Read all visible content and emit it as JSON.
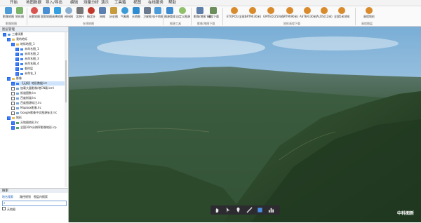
{
  "menu": [
    "开始",
    "地图数据",
    "导入/导出",
    "编辑",
    "测量分析",
    "演示",
    "工具箱",
    "视图",
    "在线服务",
    "帮助"
  ],
  "ribbon": {
    "buttons": [
      {
        "label": "影像地图",
        "icon": "image-map-icon",
        "color": "#4b9cd8"
      },
      {
        "label": "地形图",
        "icon": "terrain-map-icon",
        "color": "#7db46c"
      },
      {
        "label": "谷歌地图",
        "icon": "google-map-icon",
        "color": "#d9534f"
      },
      {
        "label": "国家地图",
        "icon": "national-map-icon",
        "color": "#4a8fd4"
      },
      {
        "label": "高德地图",
        "icon": "gaode-map-icon",
        "color": "#35a0e0"
      },
      {
        "label": "经纬网",
        "icon": "graticule-icon",
        "color": "#8ab0d0"
      },
      {
        "label": "比例尺",
        "icon": "scale-icon",
        "color": "#666666"
      },
      {
        "label": "指北针",
        "icon": "compass-icon",
        "color": "#c0392b"
      },
      {
        "label": "网格",
        "icon": "grid-icon",
        "color": "#5a7fb0"
      },
      {
        "label": "历史图",
        "icon": "history-map-icon",
        "color": "#c79a3b"
      },
      {
        "label": "气象图",
        "icon": "weather-icon",
        "color": "#3c9bd6"
      },
      {
        "label": "天地图",
        "icon": "tianditu-icon",
        "color": "#2f8cd1"
      },
      {
        "label": "卫星图",
        "icon": "satellite-icon",
        "color": "#6b7a8f"
      },
      {
        "label": "电子地图",
        "icon": "vector-map-icon",
        "color": "#4b9cd8"
      },
      {
        "label": "图源管理",
        "icon": "source-manage-icon",
        "color": "#3f8bcf"
      },
      {
        "label": "自定义图源",
        "icon": "custom-source-icon",
        "color": "#8fc16a"
      },
      {
        "label": "影像/地图下载",
        "icon": "download-icon",
        "color": "#5c7ea8"
      },
      {
        "label": "高程下载",
        "icon": "elevation-download-icon",
        "color": "#6b8e5a"
      },
      {
        "label": "ETOPO1(全球)",
        "icon": "dem-icon",
        "color": "#d98a2b"
      },
      {
        "label": "SRTM(30米)",
        "icon": "dem-icon",
        "color": "#d98a2b"
      },
      {
        "label": "GMTED(250米)",
        "icon": "dem-icon",
        "color": "#d98a2b"
      },
      {
        "label": "SRTM(90米)",
        "icon": "dem-icon",
        "color": "#d98a2b"
      },
      {
        "label": "ASTER(30米)",
        "icon": "dem-icon",
        "color": "#d98a2b"
      },
      {
        "label": "ALOS(12米)",
        "icon": "dem-icon",
        "color": "#d98a2b"
      },
      {
        "label": "全国5米地形",
        "icon": "dem-icon",
        "color": "#d98a2b"
      },
      {
        "label": "高程地形",
        "icon": "dem-icon",
        "color": "#d98a2b"
      }
    ],
    "groups": [
      "影像地图",
      "在线地图",
      "图源工具",
      "影像/地图下载",
      "地形高程下载",
      "高程图层"
    ]
  },
  "panel": {
    "title": "图层管理"
  },
  "tree": [
    {
      "label": "三维场景",
      "checked": true,
      "indent": 1
    },
    {
      "label": "我的地标",
      "checked": true,
      "indent": 2
    },
    {
      "label": "地标地图_1",
      "checked": true,
      "indent": 3
    },
    {
      "label": "未命名图_1",
      "checked": true,
      "indent": 4
    },
    {
      "label": "未命名图_2",
      "checked": true,
      "indent": 4
    },
    {
      "label": "未命名图_3",
      "checked": true,
      "indent": 4
    },
    {
      "label": "未命名图_4",
      "checked": true,
      "indent": 4
    },
    {
      "label": "临时层",
      "checked": true,
      "indent": 4
    },
    {
      "label": "未命名_1",
      "checked": true,
      "indent": 4
    },
    {
      "label": "影像",
      "checked": true,
      "indent": 2
    },
    {
      "label": "【无损】地形数据.lrc",
      "checked": true,
      "indent": 3,
      "selected": true
    },
    {
      "label": "加载大量影像/地CN载.kml",
      "checked": false,
      "indent": 3
    },
    {
      "label": "街道图数.lrc",
      "checked": false,
      "indent": 3
    },
    {
      "label": "百度街道.lrc",
      "checked": false,
      "indent": 3
    },
    {
      "label": "百度图源标注.lrc",
      "checked": false,
      "indent": 3
    },
    {
      "label": "Mapbox影像.lrc",
      "checked": false,
      "indent": 3
    },
    {
      "label": "Google影像中文图源标注.lrc",
      "checked": false,
      "indent": 3
    },
    {
      "label": "地形",
      "checked": true,
      "indent": 2
    },
    {
      "label": "天地图地形.lrc",
      "checked": true,
      "indent": 3
    },
    {
      "label": "全国30m分辨率影像地形.irp",
      "checked": true,
      "indent": 3
    }
  ],
  "search": {
    "title": "搜索",
    "tabs": [
      "地名搜索",
      "路径规划",
      "图层内搜索"
    ],
    "placeholder": "",
    "result": "天地图"
  },
  "watermark": "中科图新",
  "map_tools": [
    "hand-tool-icon",
    "select-tool-icon",
    "marker-tool-icon",
    "line-tool-icon",
    "polygon-tool-icon",
    "chart-tool-icon"
  ]
}
